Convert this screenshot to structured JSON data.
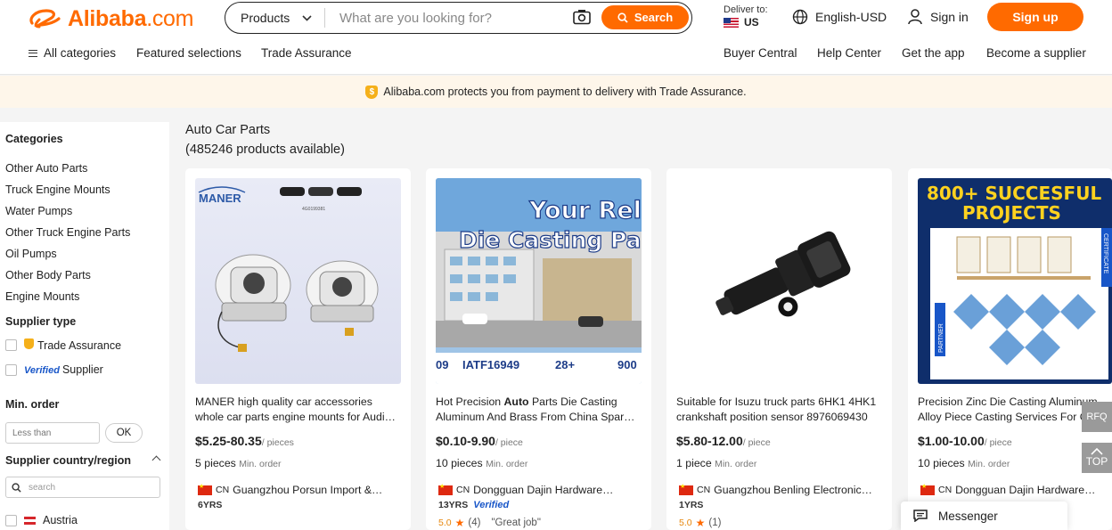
{
  "header": {
    "logo_text": "Alibaba",
    "logo_suffix": ".com",
    "search": {
      "category": "Products",
      "placeholder": "What are you looking for?",
      "button_label": "Search"
    },
    "deliver": {
      "label": "Deliver to:",
      "country": "US"
    },
    "language": "English-USD",
    "signin_label": "Sign in",
    "signup_label": "Sign up",
    "nav_left": [
      "All categories",
      "Featured selections",
      "Trade Assurance"
    ],
    "nav_right": [
      "Buyer Central",
      "Help Center",
      "Get the app",
      "Become a supplier"
    ]
  },
  "banner": {
    "text": "Alibaba.com protects you from payment to delivery with Trade Assurance."
  },
  "sidebar": {
    "categories_title": "Categories",
    "categories": [
      "Other Auto Parts",
      "Truck Engine Mounts",
      "Water Pumps",
      "Other Truck Engine Parts",
      "Oil Pumps",
      "Other Body Parts",
      "Engine Mounts"
    ],
    "supplier_type_title": "Supplier type",
    "supplier_types": [
      "Trade Assurance",
      "Supplier"
    ],
    "verified_word": "Verified",
    "min_order_title": "Min. order",
    "min_order_placeholder": "Less than",
    "ok_label": "OK",
    "region_title": "Supplier country/region",
    "region_search_placeholder": "search",
    "regions": [
      "Austria"
    ]
  },
  "main": {
    "title": "Auto Car Parts",
    "count": "(485246 products available)"
  },
  "products": [
    {
      "title_line1": "MANER high quality car accessories",
      "title_line2": "whole car parts engine mounts for Audi…",
      "price": "$5.25-80.35",
      "unit": "/ pieces",
      "moq": "5 pieces",
      "moq_label": "Min. order",
      "country": "CN",
      "supplier": "Guangzhou Porsun Import &…",
      "years": "6YRS",
      "image_brand": "MANER",
      "image_code": "4G0199381"
    },
    {
      "title_line1_pre": "Hot Precision ",
      "title_line1_bold": "Auto",
      "title_line1_post": " Parts Die Casting",
      "title_line2": "Aluminum And Brass From China Spar…",
      "price": "$0.10-9.90",
      "unit": "/ piece",
      "moq": "10 pieces",
      "moq_label": "Min. order",
      "country": "CN",
      "supplier": "Dongguan Dajin Hardware…",
      "years": "13YRS",
      "verified": "Verified",
      "rating": "5.0",
      "reviews": "(4)",
      "review_quote": "\"Great job\"",
      "image_headline_1": "Your Relia",
      "image_headline_2": "Die Casting Part",
      "image_strip": [
        "09",
        "IATF16949",
        "28+",
        "900"
      ]
    },
    {
      "title_line1": "Suitable for Isuzu truck parts 6HK1 4HK1",
      "title_line2": "crankshaft position sensor 8976069430",
      "price": "$5.80-12.00",
      "unit": "/ piece",
      "moq": "1 piece",
      "moq_label": "Min. order",
      "country": "CN",
      "supplier": "Guangzhou Benling Electronic…",
      "years": "1YRS",
      "rating": "5.0",
      "reviews": "(1)"
    },
    {
      "title_line1": "Precision Zinc Die Casting Aluminum",
      "title_line2": "Alloy Piece Casting Services For C",
      "price": "$1.00-10.00",
      "unit": "/ piece",
      "moq": "10 pieces",
      "moq_label": "Min. order",
      "country": "CN",
      "supplier": "Dongguan Dajin Hardware…",
      "image_headline_1": "800+ SUCCESFUL",
      "image_headline_2": "PROJECTS",
      "image_side_right": "CERTIFICATE",
      "image_side_left": "PARTNER"
    }
  ],
  "floating": {
    "rfq": "RFQ",
    "top": "TOP",
    "messenger": "Messenger"
  },
  "colors": {
    "brand": "#ff6a00",
    "verified": "#1856c8"
  }
}
